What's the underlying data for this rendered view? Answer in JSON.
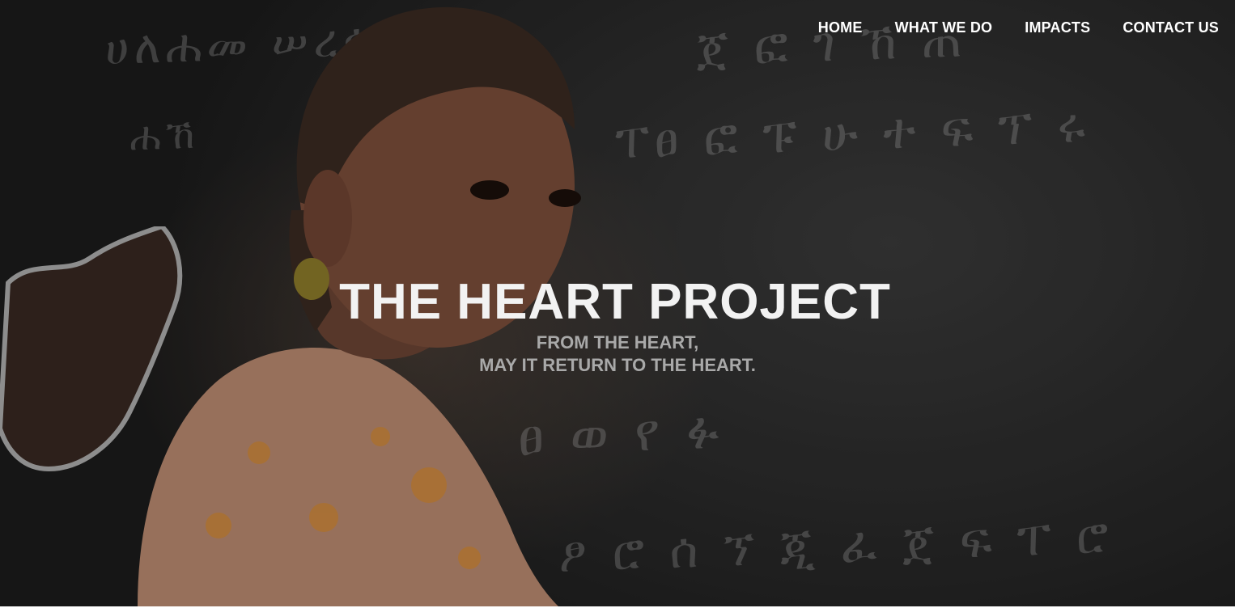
{
  "nav": {
    "items": [
      {
        "label": "HOME"
      },
      {
        "label": "WHAT WE DO"
      },
      {
        "label": "IMPACTS"
      },
      {
        "label": "CONTACT US"
      }
    ]
  },
  "hero": {
    "title": "THE HEART PROJECT",
    "tagline_line1": "FROM THE HEART,",
    "tagline_line2": "MAY IT RETURN TO THE HEART."
  },
  "colors": {
    "nav_text": "#ffffff",
    "title_text": "#f2f2f2",
    "tagline_text": "#a9a9a9",
    "background": "#262626"
  }
}
